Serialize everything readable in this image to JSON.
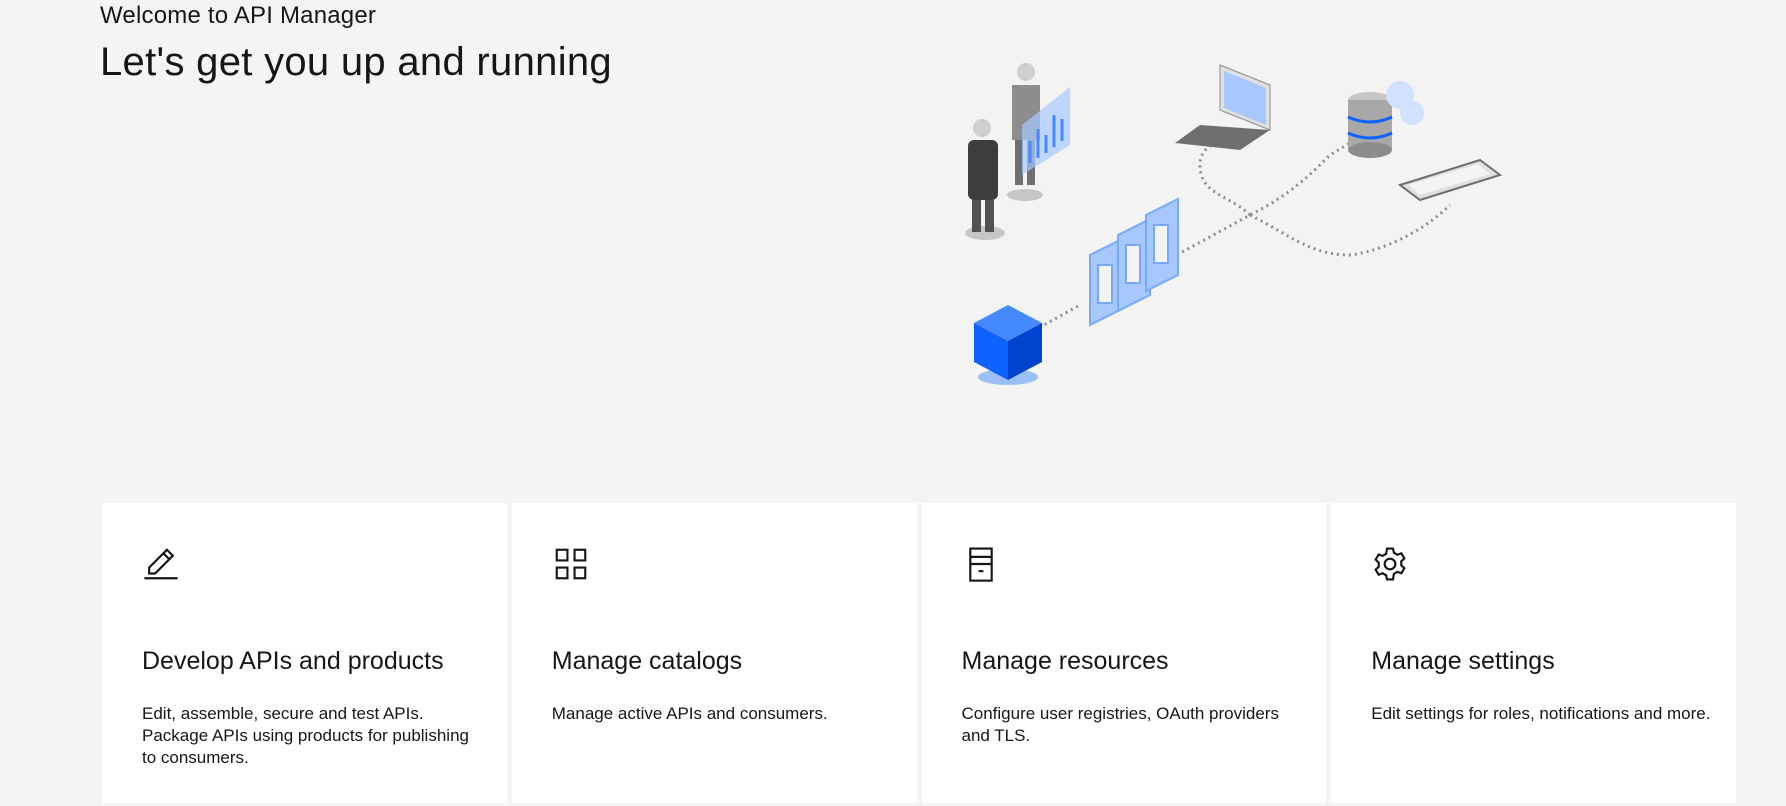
{
  "header": {
    "welcome": "Welcome to API Manager",
    "headline": "Let's get you up and running"
  },
  "illustration": {
    "name": "api-connect-illustration",
    "accent": "#0f62fe",
    "accent_light": "#a6c8ff"
  },
  "cards": [
    {
      "icon": "edit-icon",
      "title": "Develop APIs and products",
      "description": "Edit, assemble, secure and test APIs. Package APIs using products for publishing to consumers."
    },
    {
      "icon": "grid-icon",
      "title": "Manage catalogs",
      "description": "Manage active APIs and consumers."
    },
    {
      "icon": "archive-icon",
      "title": "Manage resources",
      "description": "Configure user registries, OAuth providers and TLS."
    },
    {
      "icon": "settings-icon",
      "title": "Manage settings",
      "description": "Edit settings for roles, notifications and more."
    }
  ]
}
